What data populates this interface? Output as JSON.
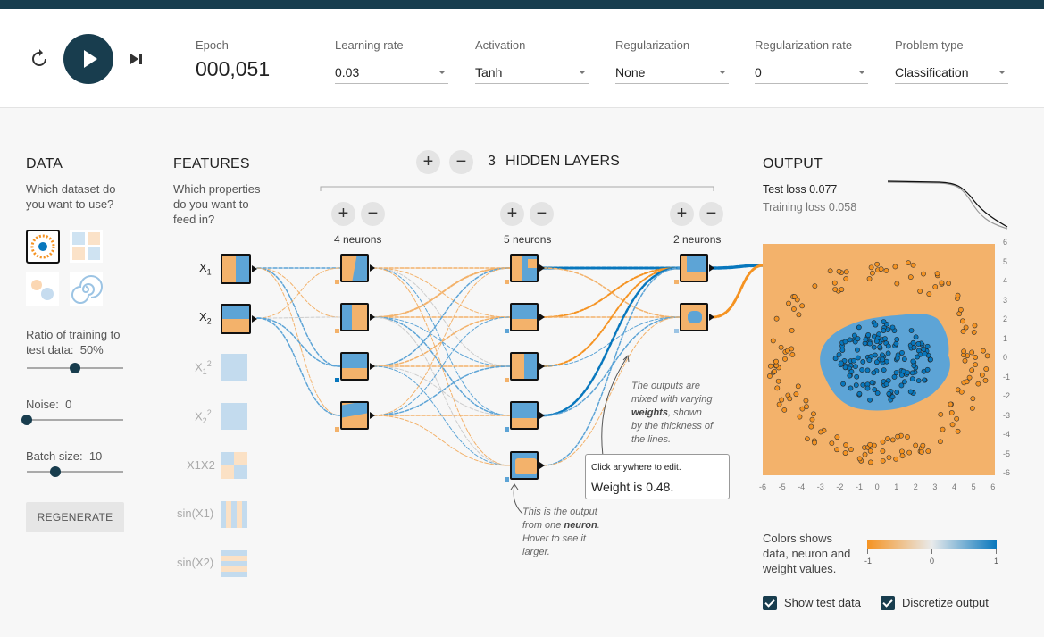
{
  "header": {
    "epoch_label": "Epoch",
    "epoch_value": "000,051",
    "controls": [
      {
        "label": "Learning rate",
        "value": "0.03"
      },
      {
        "label": "Activation",
        "value": "Tanh"
      },
      {
        "label": "Regularization",
        "value": "None"
      },
      {
        "label": "Regularization rate",
        "value": "0"
      },
      {
        "label": "Problem type",
        "value": "Classification"
      }
    ]
  },
  "data_panel": {
    "title": "DATA",
    "question": "Which dataset do you want to use?",
    "ratio_label": "Ratio of training to test data:",
    "ratio_value": "50%",
    "ratio_fraction": 0.5,
    "noise_label": "Noise:",
    "noise_value": "0",
    "noise_fraction": 0,
    "batch_label": "Batch size:",
    "batch_value": "10",
    "batch_fraction": 0.3,
    "regenerate": "REGENERATE"
  },
  "features": {
    "title": "FEATURES",
    "question": "Which properties do you want to feed in?",
    "items": [
      {
        "base": "X",
        "sub": "1",
        "sup": "",
        "active": true
      },
      {
        "base": "X",
        "sub": "2",
        "sup": "",
        "active": true
      },
      {
        "base": "X",
        "sub": "1",
        "sup": "2",
        "active": false
      },
      {
        "base": "X",
        "sub": "2",
        "sup": "2",
        "active": false
      },
      {
        "base": "X1X2",
        "sub": "",
        "sup": "",
        "active": false
      },
      {
        "base": "sin(X1)",
        "sub": "",
        "sup": "",
        "active": false
      },
      {
        "base": "sin(X2)",
        "sub": "",
        "sup": "",
        "active": false
      }
    ]
  },
  "network": {
    "layer_count": "3",
    "hidden_label": "HIDDEN LAYERS",
    "layers": [
      {
        "label": "4 neurons"
      },
      {
        "label": "5 neurons"
      },
      {
        "label": "2 neurons"
      }
    ],
    "note_weights": "The outputs are mixed with varying weights, shown by the thickness of the lines.",
    "note_weights_parts": [
      "The outputs are",
      "mixed with varying",
      "weights",
      ", shown",
      "by the thickness of",
      "the lines."
    ],
    "note_neuron_parts": [
      "This is the output",
      "from one ",
      "neuron",
      ".",
      "Hover to see it",
      "larger."
    ],
    "tooltip_hint": "Click anywhere to edit.",
    "tooltip_value": "Weight is 0.48."
  },
  "output": {
    "title": "OUTPUT",
    "test_loss": "Test loss 0.077",
    "training_loss": "Training loss 0.058",
    "y_ticks": [
      "6",
      "5",
      "4",
      "3",
      "2",
      "1",
      "0",
      "-1",
      "-2",
      "-3",
      "-4",
      "-5",
      "-6"
    ],
    "x_ticks": [
      "-6",
      "-5",
      "-4",
      "-3",
      "-2",
      "-1",
      "0",
      "1",
      "2",
      "3",
      "4",
      "5",
      "6"
    ],
    "colors_text": "Colors shows data, neuron and weight values.",
    "colors_parts": [
      "Colors shows",
      "data, neuron and",
      "weight values."
    ],
    "scale_min": "-1",
    "scale_mid": "0",
    "scale_max": "1",
    "show_test": "Show test data",
    "discretize": "Discretize output",
    "colors": {
      "orange": "#f59322",
      "blue": "#0877bd",
      "dark": "#183d4e"
    }
  }
}
